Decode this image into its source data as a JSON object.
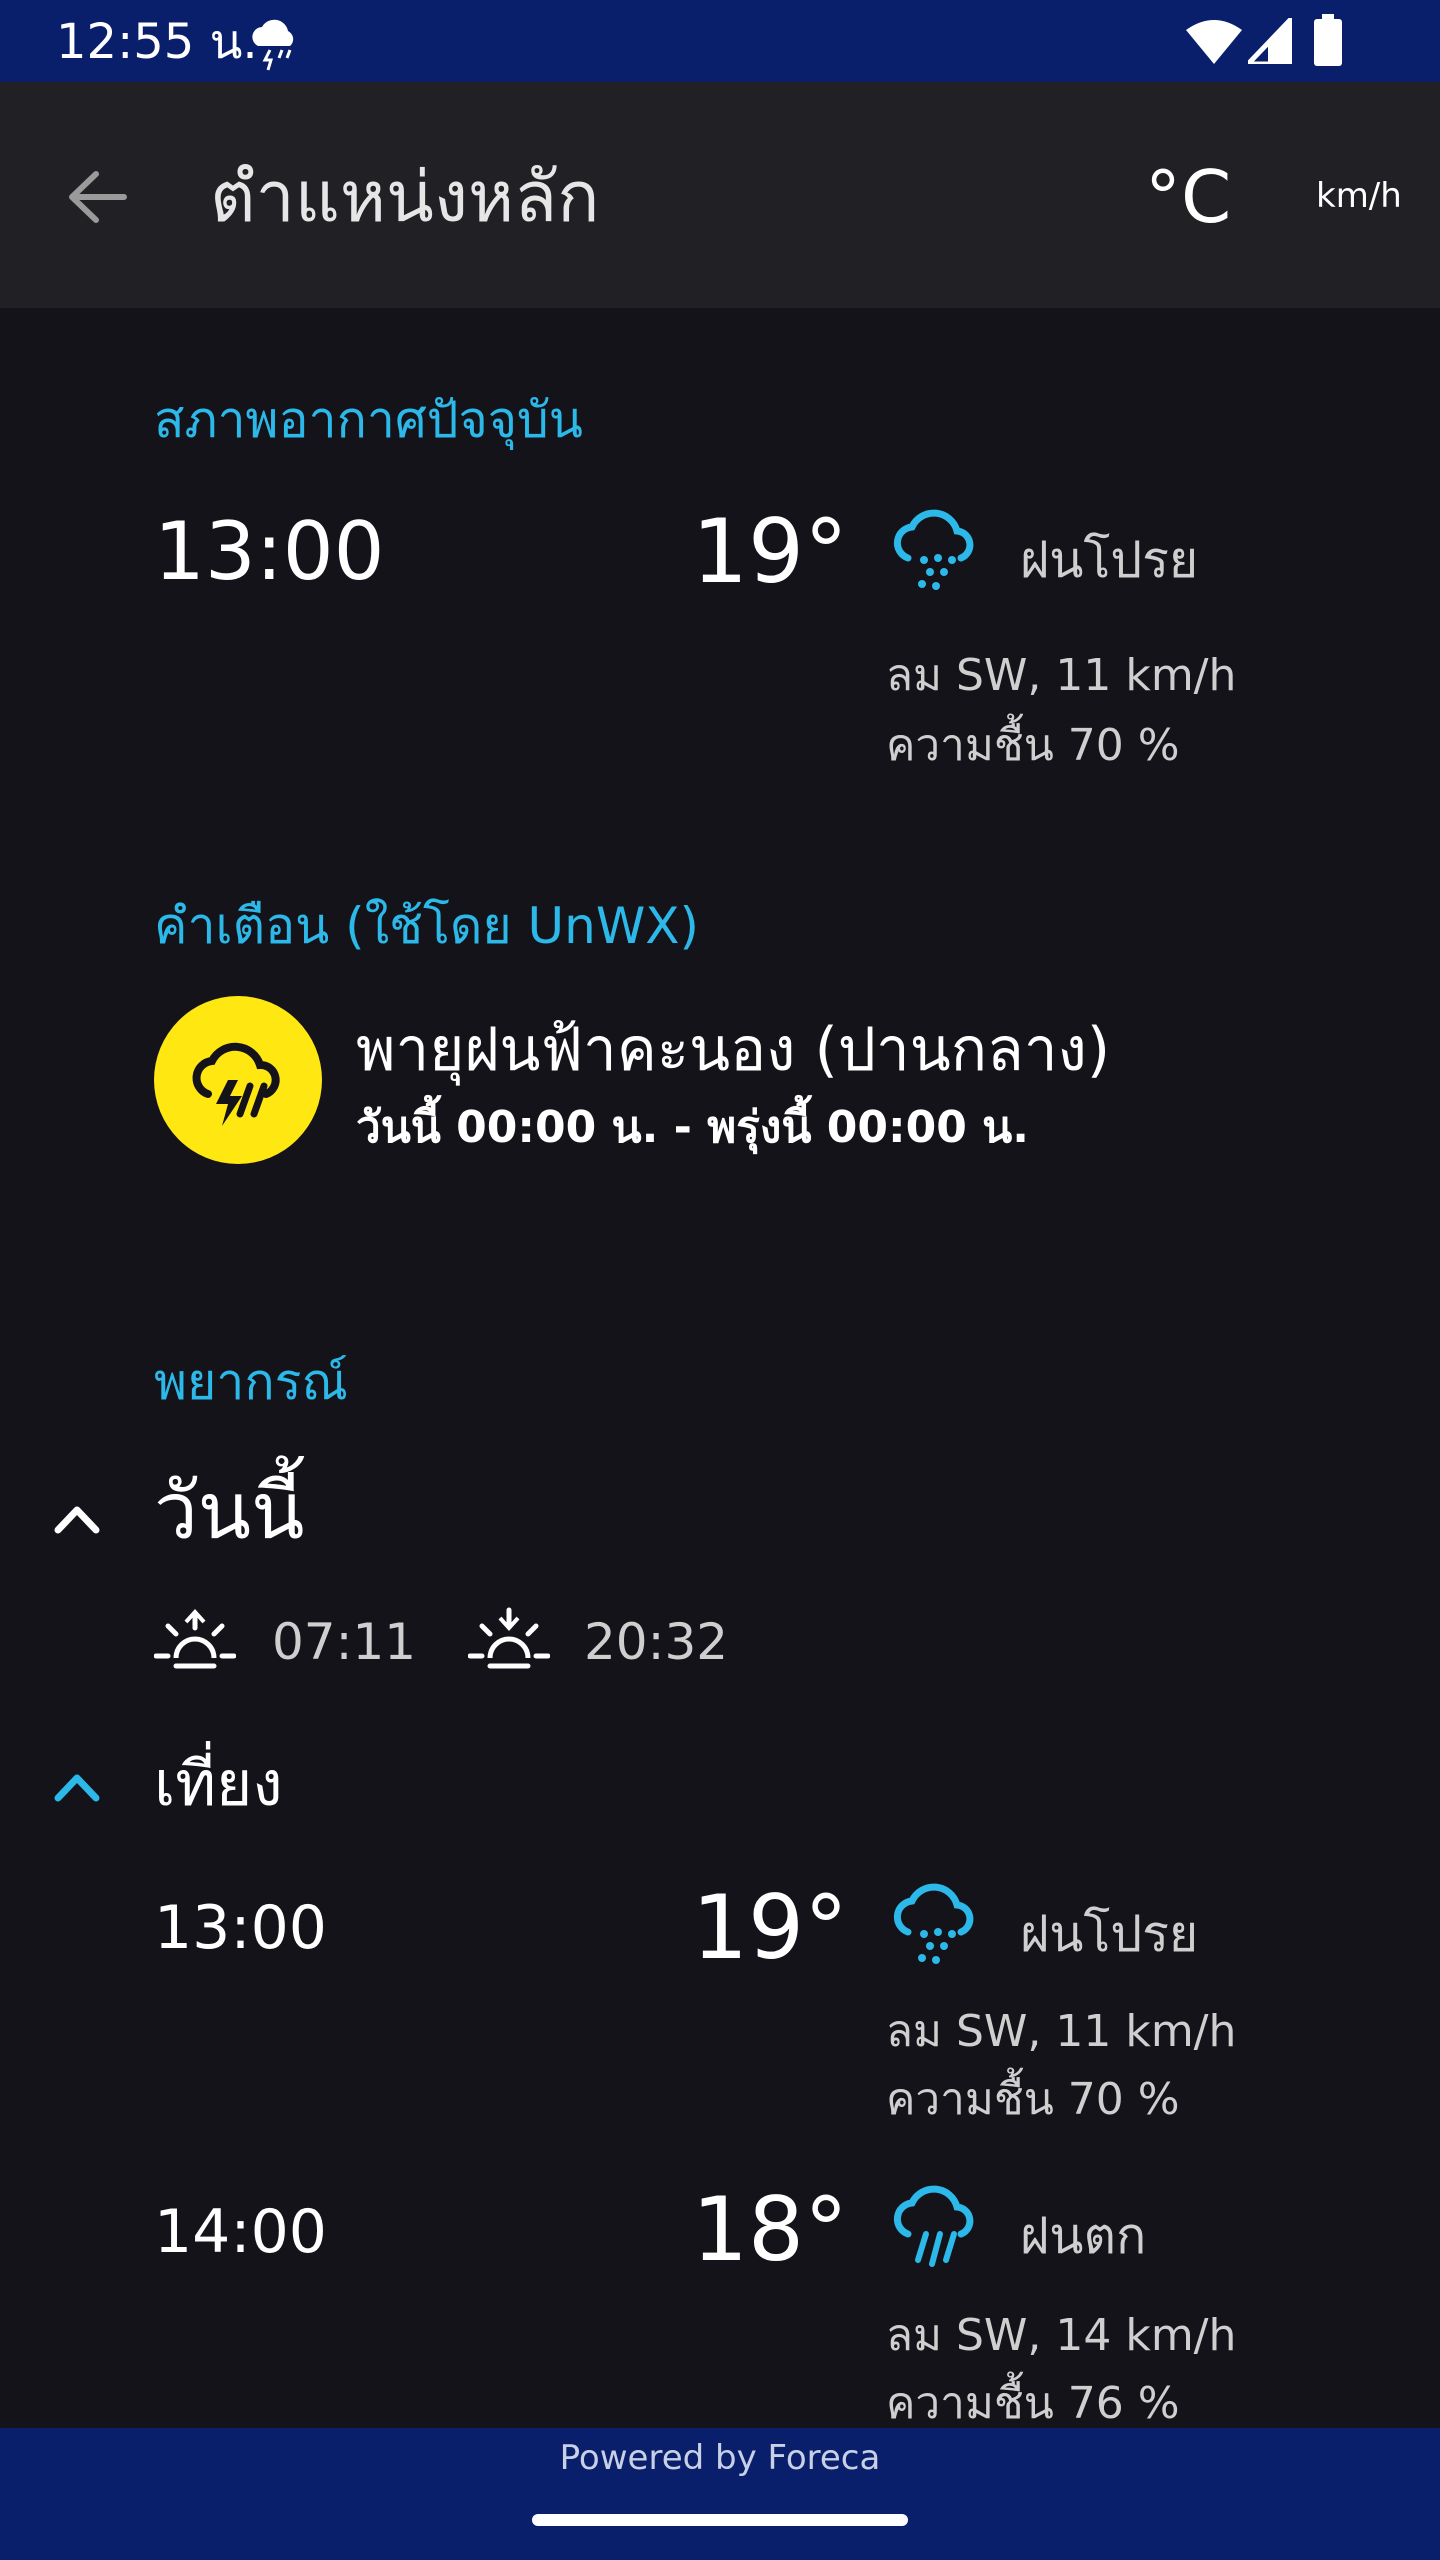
{
  "status_bar": {
    "time": "12:55 น."
  },
  "app_bar": {
    "title": "ตำแหน่งหลัก",
    "temp_unit": "°C",
    "wind_unit": "km/h"
  },
  "current": {
    "label": "สภาพอากาศปัจจุบัน",
    "time": "13:00",
    "temp": "19°",
    "condition": "ฝนโปรย",
    "wind": "ลม SW, 11 km/h",
    "humidity": "ความชื้น 70 %",
    "icon": "drizzle-icon"
  },
  "warning": {
    "label": "คำเตือน (ใช้โดย UnWX)",
    "title": "พายุฝนฟ้าคะนอง (ปานกลาง)",
    "period": "วันนี้ 00:00 น. - พรุ่งนี้ 00:00 น.",
    "icon": "thunderstorm-icon",
    "icon_bg": "#ffe812"
  },
  "forecast": {
    "label": "พยากรณ์",
    "day": "วันนี้",
    "sunrise": "07:11",
    "sunset": "20:32",
    "period": "เที่ยง",
    "rows": [
      {
        "time": "13:00",
        "temp": "19°",
        "condition": "ฝนโปรย",
        "wind": "ลม SW, 11 km/h",
        "humidity": "ความชื้น 70 %",
        "icon": "drizzle-icon"
      },
      {
        "time": "14:00",
        "temp": "18°",
        "condition": "ฝนตก",
        "wind": "ลม SW, 14 km/h",
        "humidity": "ความชื้น 76 %",
        "icon": "rain-icon"
      }
    ]
  },
  "footer": {
    "powered_by": "Powered by Foreca"
  },
  "colors": {
    "accent": "#2cb8e8",
    "status_bar": "#0a1f6b",
    "background": "#14131a",
    "app_bar": "#212125",
    "warning": "#ffe812"
  }
}
